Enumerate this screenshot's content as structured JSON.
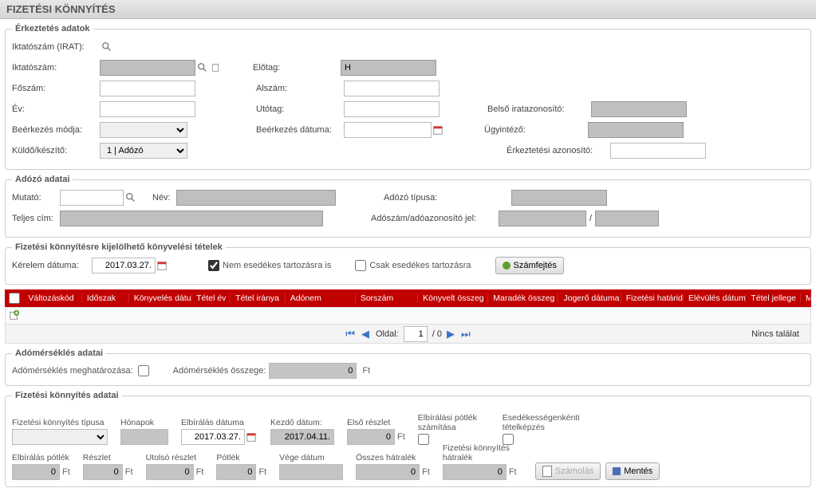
{
  "header": {
    "title": "FIZETÉSI KÖNNYÍTÉS"
  },
  "erk": {
    "legend": "Érkeztetés adatok",
    "iktatoszam_irat_label": "Iktatószám (IRAT):",
    "iktatoszam_label": "Iktatószám:",
    "foszam_label": "Főszám:",
    "ev_label": "Év:",
    "beerkezes_modja_label": "Beérkezés módja:",
    "kuldo_label": "Küldő/készítő:",
    "kuldo_value": "1 | Adózó",
    "elotag_label": "Előtag:",
    "elotag_value": "H",
    "alszam_label": "Alszám:",
    "utotag_label": "Utótag:",
    "beerkezes_datum_label": "Beérkezés dátuma:",
    "belso_label": "Belső iratazonosító:",
    "ugyintezo_label": "Ügyintéző:",
    "erkeztetesi_label": "Érkeztetési azonosító:"
  },
  "adozo": {
    "legend": "Adózó adatai",
    "mutato_label": "Mutató:",
    "nev_label": "Név:",
    "teljes_label": "Teljes cím:",
    "tipus_label": "Adózó típusa:",
    "adoszam_label": "Adószám/adóazonosító jel:",
    "slash": "/"
  },
  "kijelol": {
    "legend": "Fizetési könnyítésre kijelölhető könyvelési tételek",
    "kerelem_label": "Kérelem dátuma:",
    "kerelem_value": "2017.03.27.",
    "nemesedkes_label": "Nem esedékes tartozásra is",
    "csakesedkes_label": "Csak esedékes tartozásra",
    "szamfejtes_label": "Számfejtés"
  },
  "grid": {
    "columns": [
      "Változáskód",
      "Időszak",
      "Könyvelés dátu",
      "Tétel év",
      "Tétel iránya",
      "Adónem",
      "Sorszám",
      "Könyvelt összeg",
      "Maradék összeg",
      "Jogerő dátuma",
      "Fizetési határid",
      "Elévülés dátum",
      "Tétel jellege",
      "Megjegyzés"
    ],
    "pager_label": "Oldal:",
    "page_value": "1",
    "page_total": "/ 0",
    "no_result": "Nincs találat"
  },
  "adomersekles": {
    "legend": "Adómérséklés adatai",
    "meghat_label": "Adómérséklés meghatározása:",
    "osszeg_label": "Adómérséklés összege:",
    "osszeg_value": "0",
    "ft": "Ft"
  },
  "fk": {
    "legend": "Fizetési könnyítés adatai",
    "tipus_label": "Fizetési könnyítés típusa",
    "honapok_label": "Hónapok",
    "elb_datum_label": "Elbírálás dátuma",
    "elb_datum_value": "2017.03.27.",
    "kezdo_label": "Kezdő dátum:",
    "kezdo_value": "2017.04.11.",
    "elso_reszlet_label": "Első részlet",
    "elso_reszlet_value": "0",
    "elb_potlek_szam_label": "Elbírálási pótlék számítása",
    "esed_label": "Esedékességenkénti tételképzés",
    "elb_potlek_label": "Elbírálás pótlék",
    "elb_potlek_value": "0",
    "reszlet_label": "Részlet",
    "reszlet_value": "0",
    "utolso_label": "Utolsó részlet",
    "utolso_value": "0",
    "potlek_label": "Pótlék",
    "potlek_value": "0",
    "vege_label": "Vége dátum",
    "osszes_label": "Összes hátralék",
    "osszes_value": "0",
    "fkhatralek_label": "Fizetési könnyítés hátralék",
    "fkhatralek_value": "0",
    "szamolas_label": "Számolás",
    "mentes_label": "Mentés",
    "ft": "Ft"
  }
}
